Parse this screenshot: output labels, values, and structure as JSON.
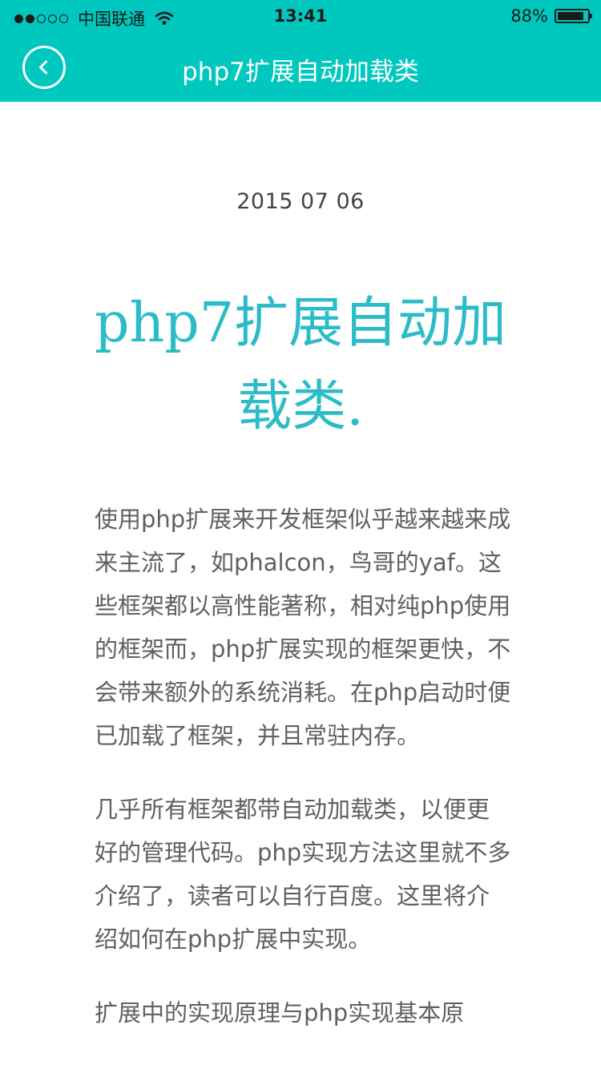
{
  "status_bar": {
    "carrier": "中国联通",
    "time": "13:41",
    "battery_percent": "88%",
    "battery_level": 0.88,
    "signal_bars_filled": 2,
    "signal_bars_total": 5
  },
  "nav": {
    "title": "php7扩展自动加载类",
    "back_icon": "chevron-left-circle-icon"
  },
  "article": {
    "date": "2015 07 06",
    "title": "php7扩展自动加载类.",
    "paragraphs": [
      "使用php扩展来开发框架似乎越来越来成来主流了，如phalcon，鸟哥的yaf。这些框架都以高性能著称，相对纯php使用的框架而，php扩展实现的框架更快，不会带来额外的系统消耗。在php启动时便已加载了框架，并且常驻内存。",
      "几乎所有框架都带自动加载类，以便更好的管理代码。php实现方法这里就不多介绍了，读者可以自行百度。这里将介绍如何在php扩展中实现。",
      "扩展中的实现原理与php实现基本原"
    ]
  },
  "colors": {
    "header_bg": "#00c8be",
    "title_color": "#2bbcc8",
    "body_text": "#606060"
  }
}
